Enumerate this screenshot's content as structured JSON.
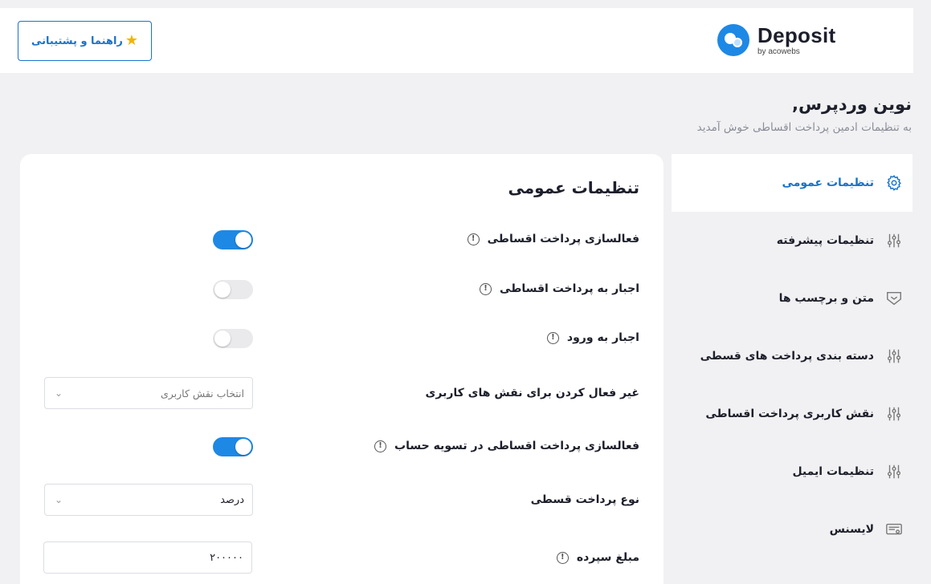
{
  "header": {
    "support_label": "راهنما و پشتیبانی",
    "logo_name": "Deposit",
    "logo_sub": "by acowebs"
  },
  "greeting": {
    "title": "نوین وردپرس,",
    "subtitle": "به تنظیمات ادمین پرداخت اقساطی خوش آمدید"
  },
  "sidebar": {
    "items": [
      {
        "label": "تنظیمات عمومی",
        "icon": "gear-icon",
        "active": true
      },
      {
        "label": "تنظیمات پیشرفته",
        "icon": "sliders-icon"
      },
      {
        "label": "متن و برچسب ها",
        "icon": "tag-icon"
      },
      {
        "label": "دسته بندی پرداخت های قسطی",
        "icon": "sliders-icon"
      },
      {
        "label": "نقش کاربری پرداخت اقساطی",
        "icon": "sliders-icon"
      },
      {
        "label": "تنظیمات ایمیل",
        "icon": "sliders-icon"
      },
      {
        "label": "لایسنس",
        "icon": "license-icon"
      }
    ]
  },
  "main": {
    "title": "تنظیمات عمومی",
    "rows": [
      {
        "label": "فعالسازی پرداخت اقساطی",
        "type": "toggle",
        "on": true,
        "info": true
      },
      {
        "label": "اجبار به پرداخت اقساطی",
        "type": "toggle",
        "on": false,
        "info": true
      },
      {
        "label": "اجبار به ورود",
        "type": "toggle",
        "on": false,
        "info": true
      },
      {
        "label": "غیر فعال کردن برای نقش های کاربری",
        "type": "select",
        "placeholder": "انتخاب نقش کاربری",
        "info": false
      },
      {
        "label": "فعالسازی پرداخت اقساطی در تسویه حساب",
        "type": "toggle",
        "on": true,
        "info": true
      },
      {
        "label": "نوع پرداخت قسطی",
        "type": "select",
        "value": "درصد",
        "info": false
      },
      {
        "label": "مبلغ سپرده",
        "type": "number",
        "value": "۲۰۰۰۰۰",
        "info": true
      }
    ]
  },
  "colors": {
    "accent": "#1e88e5",
    "link": "#1a73c8",
    "star": "#f5b301"
  }
}
